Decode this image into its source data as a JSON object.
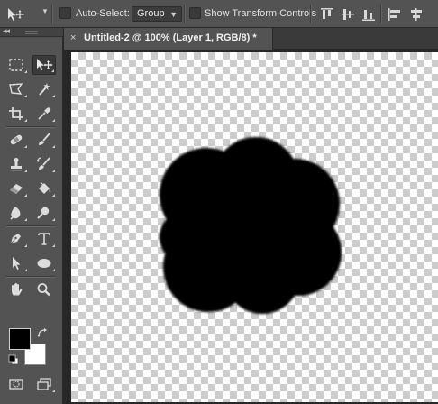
{
  "options_bar": {
    "auto_select_label": "Auto-Select:",
    "auto_select_checked": false,
    "auto_select_mode": "Group",
    "show_transform_label": "Show Transform Controls",
    "show_transform_checked": false,
    "align_icons": [
      "align-top-edges-icon",
      "align-vertical-centers-icon",
      "align-bottom-edges-icon",
      "align-left-edges-icon",
      "align-horizontal-centers-icon"
    ]
  },
  "document_tab": {
    "close_glyph": "×",
    "title": "Untitled-2 @ 100% (Layer 1, RGB/8) *"
  },
  "toolbox": {
    "collapse_glyph": "◂◂",
    "tools": [
      [
        "rectangular-marquee-tool",
        "move-tool"
      ],
      [
        "lasso-tool",
        "magic-wand-tool"
      ],
      [
        "crop-tool",
        "eyedropper-tool"
      ],
      [
        "spot-healing-brush-tool",
        "brush-tool"
      ],
      [
        "clone-stamp-tool",
        "history-brush-tool"
      ],
      [
        "eraser-tool",
        "paint-bucket-tool"
      ],
      [
        "blur-tool",
        "dodge-tool"
      ],
      [
        "pen-tool",
        "type-tool"
      ],
      [
        "path-selection-tool",
        "ellipse-tool"
      ],
      [
        "hand-tool",
        "zoom-tool"
      ]
    ],
    "active_tool": "move-tool",
    "foreground_color": "#000000",
    "background_color": "#ffffff"
  },
  "canvas": {
    "background": "transparent",
    "shape_color": "#000000"
  }
}
